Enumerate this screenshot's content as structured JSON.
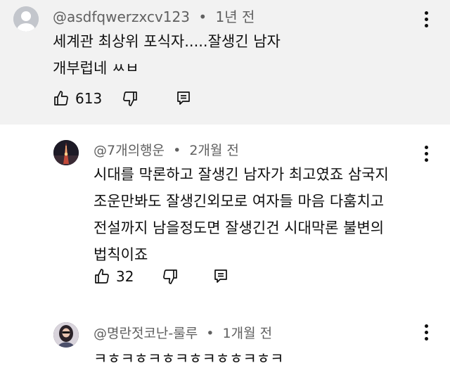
{
  "comments": [
    {
      "author": "@asdfqwerzxcv123",
      "separator": "•",
      "time": "1년 전",
      "lines": [
        "세계관 최상위 포식자.....잘생긴 남자",
        "개부럽네 ㅆㅂ"
      ],
      "likes": "613"
    },
    {
      "author": "@7개의행운",
      "separator": "•",
      "time": "2개월 전",
      "lines": [
        "시대를 막론하고 잘생긴 남자가 최고였죠 삼국지",
        "조운만봐도 잘생긴외모로 여자들 마음 다훔치고",
        "전설까지 남을정도면 잘생긴건 시대막론 불변의",
        "법칙이죠"
      ],
      "likes": "32"
    },
    {
      "author": "@명란젓코난-룰루",
      "separator": "•",
      "time": "1개월 전",
      "lines": [
        "ㅋㅎㅋㅎㅋㅎㅋㅎㅋㅎㅎㅋㅎㅋ"
      ]
    }
  ],
  "icons": {
    "like": "thumbs-up-icon",
    "dislike": "thumbs-down-icon",
    "reply": "reply-comment-icon",
    "menu": "more-vertical-icon"
  },
  "colors": {
    "highlight_bg": "#f2f2f2",
    "meta_text": "#606060",
    "text": "#0f0f0f"
  }
}
